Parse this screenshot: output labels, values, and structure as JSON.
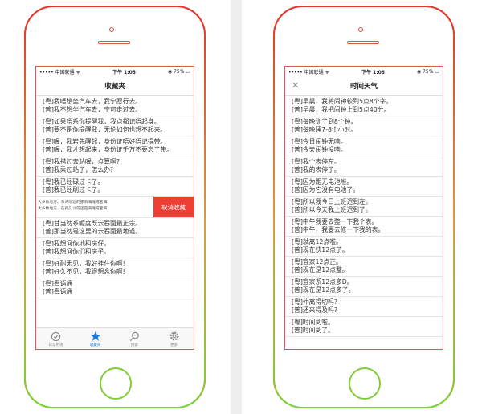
{
  "left": {
    "status": {
      "carrier": "••••• 中国联通 ᯤ",
      "time": "下午 1:05",
      "battery": "◉ 75% ▭"
    },
    "title": "收藏夹",
    "items": [
      {
        "a": "[粤]我唔想坐汽车去，我宁愿行去。",
        "b": "[普]我不想坐汽车去，宁可走过去。"
      },
      {
        "a": "[粤]如果唔系你提醒我，我点都记唔起身。",
        "b": "[普]要不是你提醒我，无论如何也想不起来。"
      },
      {
        "a": "[粤]喔，我岩先醒起，身份证唔好唔记得带。",
        "b": "[普]喔，我才想起来，身份证千万不要忘了带。"
      },
      {
        "a": "[粤]我搭过去站喔，点算啊?",
        "b": "[普]我乘过站了，怎么办?"
      },
      {
        "a": "[粤]我已经碌过卡了。",
        "b": "[普]我已经刷过卡了。"
      }
    ],
    "swipe": {
      "line1": "大多数地方。系好附近的都系海滩或者海。",
      "line2": "大多数地方，在很久以前还是海滩或者海。",
      "button": "取消收藏"
    },
    "items2": [
      {
        "a": "[粤]甘当然系呢度既云吞面最正宗。",
        "b": "[普]那当然是这里的云吞面最地道。"
      },
      {
        "a": "[粤]我想问你地租房仔。",
        "b": "[普]我想问你们租房子。"
      },
      {
        "a": "[粤]好耐无见，我好挂住你啊!",
        "b": "[普]好久不见，我很想念你啊!"
      },
      {
        "a": "[粤]粤语通",
        "b": "[普]粤语通"
      }
    ],
    "tabs": [
      {
        "label": "日常用语",
        "icon": "clock-icon"
      },
      {
        "label": "收藏夹",
        "icon": "star-icon"
      },
      {
        "label": "搜索",
        "icon": "search-icon"
      },
      {
        "label": "更多",
        "icon": "gear-icon"
      }
    ]
  },
  "right": {
    "status": {
      "carrier": "••••• 中国联通 ᯤ",
      "time": "下午 1:08",
      "battery": "◉ 75% ▭"
    },
    "title": "时间天气",
    "close_symbol": "✕",
    "items": [
      {
        "a": "[粤]早晨，我将闹钟较到5点8个字。",
        "b": "[普]早晨，我把闹钟上到5点40分。"
      },
      {
        "a": "[粤]每晚训了到8个钟。",
        "b": "[普]每晚睡7-8个小时。"
      },
      {
        "a": "[粤]今日闹钟无响。",
        "b": "[普]今天闹钟没响。"
      },
      {
        "a": "[粤]我个表停左。",
        "b": "[普]我的表停了。"
      },
      {
        "a": "[粤]因为距无电池啦。",
        "b": "[普]因为它没有电池了。"
      },
      {
        "a": "[粤]所以我今日上班迟到左。",
        "b": "[普]所以今天我上班迟到了。"
      },
      {
        "a": "[粤]中午我要去整一下我个表。",
        "b": "[普]中午，我要去修一下我的表。"
      },
      {
        "a": "[粤]就离12点啦。",
        "b": "[普]现在快12点了。"
      },
      {
        "a": "[粤]宜家12点正。",
        "b": "[普]现在是12点整。"
      },
      {
        "a": "[粤]宜家系12点多D。",
        "b": "[普]现在是12点多了。"
      },
      {
        "a": "[粤]仲离得切吗?",
        "b": "[普]还来得及吗?"
      },
      {
        "a": "[粤]时间到啦。",
        "b": "[普]时间到了。"
      }
    ]
  },
  "colors": {
    "frame_top": "#e8322a",
    "frame_bottom": "#77d42e",
    "swipe_button": "#ef3e34",
    "tab_active": "#1e7be0"
  }
}
